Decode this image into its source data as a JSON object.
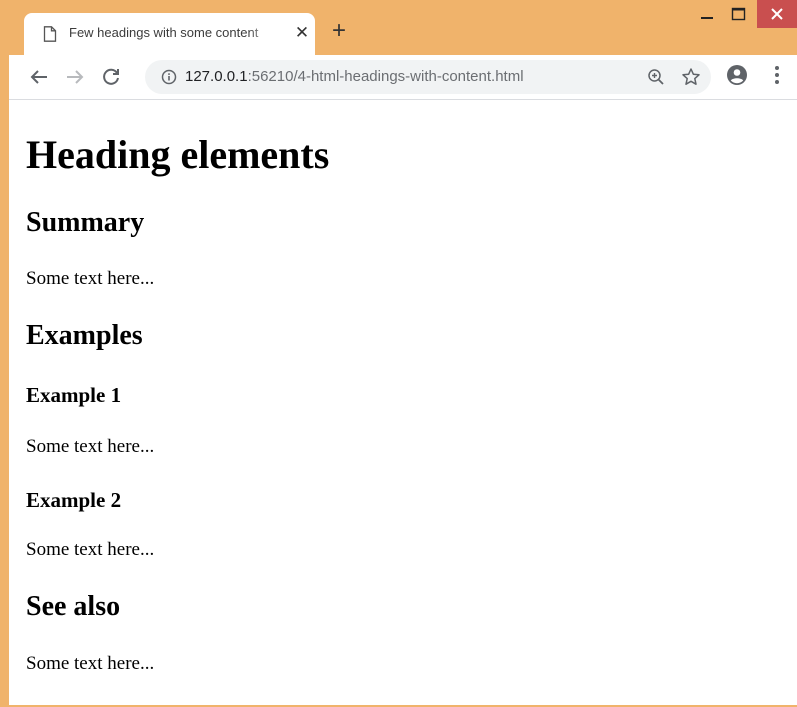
{
  "browser": {
    "tab_title": "Few headings with some content",
    "tab_close": "✕",
    "new_tab": "+",
    "url_host": "127.0.0.1",
    "url_path": ":56210/4-html-headings-with-content.html",
    "icons": [
      "page-icon",
      "back-icon",
      "forward-icon",
      "reload-icon",
      "info-icon",
      "zoom-icon",
      "star-icon",
      "account-icon",
      "menu-icon",
      "minimize-icon",
      "maximize-icon",
      "close-icon"
    ],
    "accent": "#f0b36b"
  },
  "page": {
    "h1": "Heading elements",
    "sections": [
      {
        "heading": "Summary",
        "text": "Some text here..."
      },
      {
        "heading": "Examples"
      },
      {
        "heading": "Example 1",
        "text": "Some text here..."
      },
      {
        "heading": "Example 2",
        "text": "Some text here..."
      },
      {
        "heading": "See also",
        "text": "Some text here..."
      }
    ]
  }
}
